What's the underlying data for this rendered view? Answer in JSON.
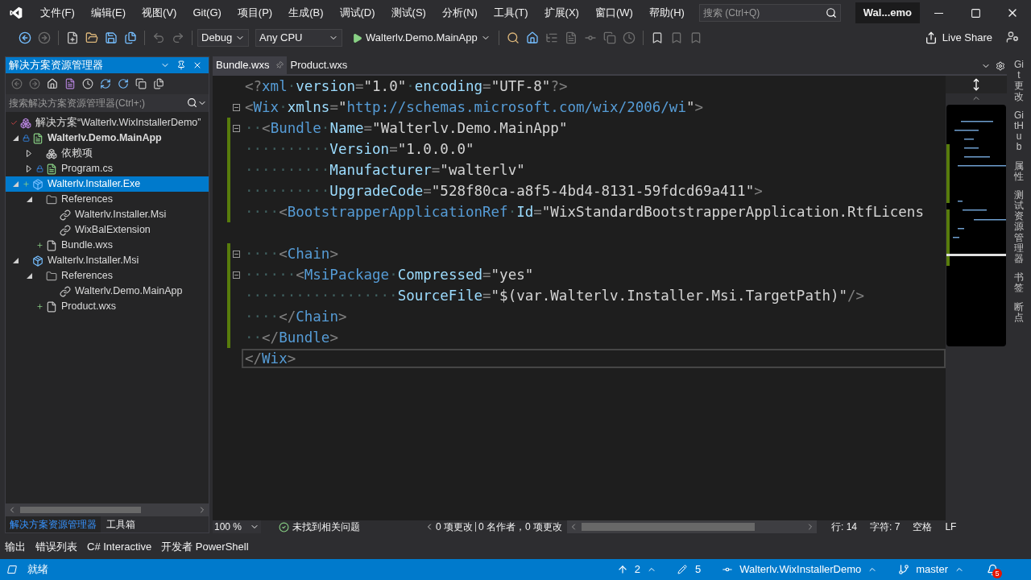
{
  "title_bar": {
    "menus": [
      "文件(F)",
      "编辑(E)",
      "视图(V)",
      "Git(G)",
      "项目(P)",
      "生成(B)",
      "调试(D)",
      "测试(S)",
      "分析(N)",
      "工具(T)",
      "扩展(X)",
      "窗口(W)",
      "帮助(H)"
    ],
    "search": {
      "placeholder": "搜索 (Ctrl+Q)"
    },
    "solution_badge": "Wal...emo"
  },
  "toolbar": {
    "configuration": "Debug",
    "platform": "Any CPU",
    "start_target": "Walterlv.Demo.MainApp",
    "live_share": "Live Share"
  },
  "solution_explorer": {
    "title": "解决方案资源管理器",
    "search": {
      "placeholder": "搜索解决方案资源管理器(Ctrl+;)"
    },
    "tree": [
      {
        "label": "解决方案“Walterlv.WixInstallerDemo”",
        "kind": "solution",
        "checked_out": true,
        "locked": false,
        "added": false,
        "bold": false,
        "selected": false,
        "children": [
          {
            "label": "Walterlv.Demo.MainApp",
            "kind": "csproj",
            "checked_out": false,
            "locked": true,
            "added": false,
            "bold": true,
            "selected": false,
            "expanded": true,
            "children": [
              {
                "label": "依赖项",
                "kind": "deps",
                "checked_out": false,
                "locked": false,
                "added": false,
                "bold": false,
                "selected": false,
                "expanded": false
              },
              {
                "label": "Program.cs",
                "kind": "cs",
                "checked_out": false,
                "locked": true,
                "added": false,
                "bold": false,
                "selected": false,
                "expanded": false
              }
            ]
          },
          {
            "label": "Walterlv.Installer.Exe",
            "kind": "wixproj",
            "checked_out": false,
            "locked": false,
            "added": true,
            "bold": false,
            "selected": true,
            "expanded": true,
            "children": [
              {
                "label": "References",
                "kind": "folder",
                "checked_out": false,
                "locked": false,
                "added": false,
                "bold": false,
                "selected": false,
                "expanded": true,
                "children": [
                  {
                    "label": "Walterlv.Installer.Msi",
                    "kind": "reference",
                    "checked_out": false,
                    "locked": false,
                    "added": false,
                    "bold": false,
                    "selected": false
                  },
                  {
                    "label": "WixBalExtension",
                    "kind": "reference",
                    "checked_out": false,
                    "locked": false,
                    "added": false,
                    "bold": false,
                    "selected": false
                  }
                ]
              },
              {
                "label": "Bundle.wxs",
                "kind": "file",
                "checked_out": false,
                "locked": false,
                "added": true,
                "bold": false,
                "selected": false
              }
            ]
          },
          {
            "label": "Walterlv.Installer.Msi",
            "kind": "wixproj",
            "checked_out": false,
            "locked": false,
            "added": false,
            "bold": false,
            "selected": false,
            "expanded": true,
            "children": [
              {
                "label": "References",
                "kind": "folder",
                "checked_out": false,
                "locked": false,
                "added": false,
                "bold": false,
                "selected": false,
                "expanded": true,
                "children": [
                  {
                    "label": "Walterlv.Demo.MainApp",
                    "kind": "reference",
                    "checked_out": false,
                    "locked": false,
                    "added": false,
                    "bold": false,
                    "selected": false
                  }
                ]
              },
              {
                "label": "Product.wxs",
                "kind": "file",
                "checked_out": false,
                "locked": false,
                "added": true,
                "bold": false,
                "selected": false
              }
            ]
          }
        ]
      }
    ],
    "bottom_tabs": [
      {
        "label": "解决方案资源管理器",
        "selected": true
      },
      {
        "label": "工具箱",
        "selected": false
      }
    ]
  },
  "editor": {
    "tabs": [
      {
        "label": "Bundle.wxs",
        "selected": true
      },
      {
        "label": "Product.wxs",
        "selected": false
      }
    ],
    "lines": [
      {
        "fold": false,
        "changed": false,
        "current": false,
        "tokens": [
          {
            "kind": "delimiter",
            "text": "<?"
          },
          {
            "kind": "tag",
            "text": "xml"
          },
          {
            "kind": "space",
            "text": "·"
          },
          {
            "kind": "attribute",
            "text": "version"
          },
          {
            "kind": "delimiter",
            "text": "="
          },
          {
            "kind": "value",
            "text": "\"1.0\""
          },
          {
            "kind": "space",
            "text": "·"
          },
          {
            "kind": "attribute",
            "text": "encoding"
          },
          {
            "kind": "delimiter",
            "text": "="
          },
          {
            "kind": "value",
            "text": "\"UTF-8\""
          },
          {
            "kind": "delimiter",
            "text": "?>"
          }
        ]
      },
      {
        "fold": true,
        "changed": false,
        "current": false,
        "tokens": [
          {
            "kind": "delimiter",
            "text": "<"
          },
          {
            "kind": "tag",
            "text": "Wix"
          },
          {
            "kind": "space",
            "text": "·"
          },
          {
            "kind": "attribute",
            "text": "xmlns"
          },
          {
            "kind": "delimiter",
            "text": "="
          },
          {
            "kind": "value",
            "text": "\""
          },
          {
            "kind": "url",
            "text": "http://schemas.microsoft.com/wix/2006/wi"
          },
          {
            "kind": "value",
            "text": "\""
          },
          {
            "kind": "delimiter",
            "text": ">"
          }
        ]
      },
      {
        "fold": true,
        "changed": true,
        "current": false,
        "tokens": [
          {
            "kind": "space",
            "text": "··"
          },
          {
            "kind": "delimiter",
            "text": "<"
          },
          {
            "kind": "tag",
            "text": "Bundle"
          },
          {
            "kind": "space",
            "text": "·"
          },
          {
            "kind": "attribute",
            "text": "Name"
          },
          {
            "kind": "delimiter",
            "text": "="
          },
          {
            "kind": "value",
            "text": "\"Walterlv.Demo.MainApp\""
          }
        ]
      },
      {
        "fold": false,
        "changed": true,
        "current": false,
        "tokens": [
          {
            "kind": "space",
            "text": "··········"
          },
          {
            "kind": "attribute",
            "text": "Version"
          },
          {
            "kind": "delimiter",
            "text": "="
          },
          {
            "kind": "value",
            "text": "\"1.0.0.0\""
          }
        ]
      },
      {
        "fold": false,
        "changed": true,
        "current": false,
        "tokens": [
          {
            "kind": "space",
            "text": "··········"
          },
          {
            "kind": "attribute",
            "text": "Manufacturer"
          },
          {
            "kind": "delimiter",
            "text": "="
          },
          {
            "kind": "value",
            "text": "\"walterlv\""
          }
        ]
      },
      {
        "fold": false,
        "changed": true,
        "current": false,
        "tokens": [
          {
            "kind": "space",
            "text": "··········"
          },
          {
            "kind": "attribute",
            "text": "UpgradeCode"
          },
          {
            "kind": "delimiter",
            "text": "="
          },
          {
            "kind": "value",
            "text": "\"528f80ca-a8f5-4bd4-8131-59fdcd69a411\""
          },
          {
            "kind": "delimiter",
            "text": ">"
          }
        ]
      },
      {
        "fold": false,
        "changed": true,
        "current": false,
        "tokens": [
          {
            "kind": "space",
            "text": "····"
          },
          {
            "kind": "delimiter",
            "text": "<"
          },
          {
            "kind": "tag",
            "text": "BootstrapperApplicationRef"
          },
          {
            "kind": "space",
            "text": "·"
          },
          {
            "kind": "attribute",
            "text": "Id"
          },
          {
            "kind": "delimiter",
            "text": "="
          },
          {
            "kind": "value",
            "text": "\"WixStandardBootstrapperApplication.RtfLicens"
          }
        ]
      },
      {
        "fold": false,
        "changed": false,
        "current": false
      },
      {
        "fold": true,
        "changed": true,
        "current": false,
        "tokens": [
          {
            "kind": "space",
            "text": "····"
          },
          {
            "kind": "delimiter",
            "text": "<"
          },
          {
            "kind": "tag",
            "text": "Chain"
          },
          {
            "kind": "delimiter",
            "text": ">"
          }
        ]
      },
      {
        "fold": true,
        "changed": true,
        "current": false,
        "tokens": [
          {
            "kind": "space",
            "text": "······"
          },
          {
            "kind": "delimiter",
            "text": "<"
          },
          {
            "kind": "tag",
            "text": "MsiPackage"
          },
          {
            "kind": "space",
            "text": "·"
          },
          {
            "kind": "attribute",
            "text": "Compressed"
          },
          {
            "kind": "delimiter",
            "text": "="
          },
          {
            "kind": "value",
            "text": "\"yes\""
          }
        ]
      },
      {
        "fold": false,
        "changed": true,
        "current": false,
        "tokens": [
          {
            "kind": "space",
            "text": "··················"
          },
          {
            "kind": "attribute",
            "text": "SourceFile"
          },
          {
            "kind": "delimiter",
            "text": "="
          },
          {
            "kind": "value",
            "text": "\"$(var.Walterlv.Installer.Msi.TargetPath)\""
          },
          {
            "kind": "delimiter",
            "text": "/>"
          }
        ]
      },
      {
        "fold": false,
        "changed": true,
        "current": false,
        "tokens": [
          {
            "kind": "space",
            "text": "····"
          },
          {
            "kind": "delimiter",
            "text": "</"
          },
          {
            "kind": "tag",
            "text": "Chain"
          },
          {
            "kind": "delimiter",
            "text": ">"
          }
        ]
      },
      {
        "fold": false,
        "changed": true,
        "current": false,
        "tokens": [
          {
            "kind": "space",
            "text": "··"
          },
          {
            "kind": "delimiter",
            "text": "</"
          },
          {
            "kind": "tag",
            "text": "Bundle"
          },
          {
            "kind": "delimiter",
            "text": ">"
          }
        ]
      },
      {
        "fold": false,
        "changed": false,
        "current": true,
        "tokens": [
          {
            "kind": "delimiter",
            "text": "</"
          },
          {
            "kind": "tag",
            "text": "Wix"
          },
          {
            "kind": "delimiter",
            "text": ">"
          }
        ]
      }
    ],
    "status": {
      "zoom": "100 %",
      "issues": "未找到相关问题",
      "changes": "0 项更改",
      "authors": "0 名作者，0 项更改",
      "line": "行: 14",
      "column": "字符: 7",
      "indent": "空格",
      "line_ending": "LF"
    }
  },
  "right_tabs": [
    "Git 更改",
    "GitHub",
    "属性",
    "测试资源管理器",
    "书签",
    "断点"
  ],
  "tool_tabs": [
    "输出",
    "错误列表",
    "C# Interactive",
    "开发者 PowerShell"
  ],
  "status_bar": {
    "message": "就绪",
    "unpushed": "2",
    "pending": "5",
    "repository": "Walterlv.WixInstallerDemo",
    "branch": "master",
    "notifications": "5"
  }
}
